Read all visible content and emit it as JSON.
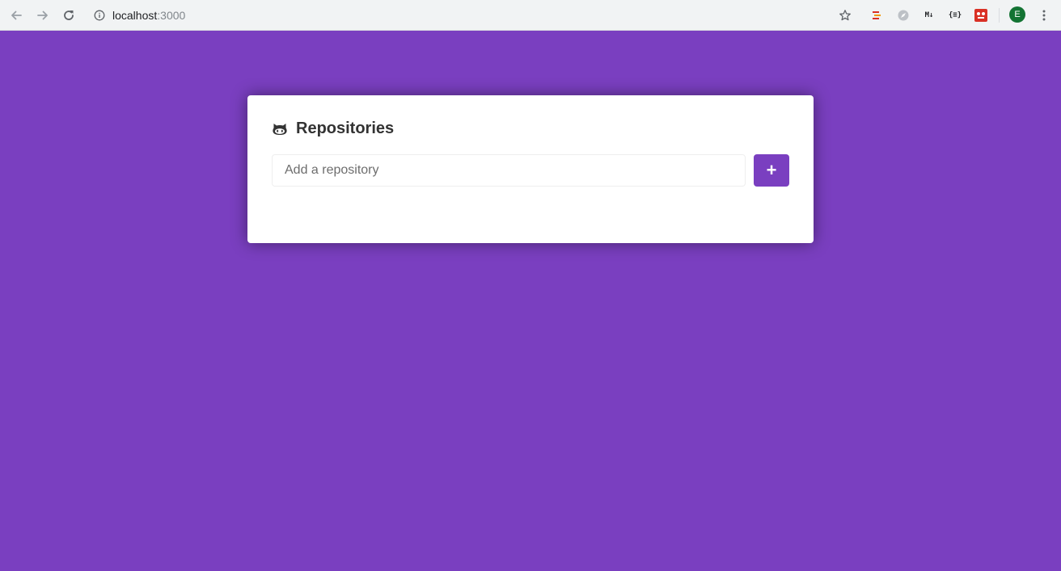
{
  "browser": {
    "url_host": "localhost",
    "url_port": ":3000",
    "profile_initial": "E",
    "extensions": {
      "markdown_label": "M↓",
      "json_label": "{≡}"
    },
    "icons": [
      "back-icon",
      "forward-icon",
      "reload-icon",
      "info-icon",
      "star-icon"
    ]
  },
  "card": {
    "title": "Repositories",
    "title_icon": "github-icon",
    "input_placeholder": "Add a repository",
    "add_button_label": "+"
  },
  "colors": {
    "background": "#7a3fc0",
    "accent": "#7a3fc0",
    "card": "#ffffff"
  }
}
